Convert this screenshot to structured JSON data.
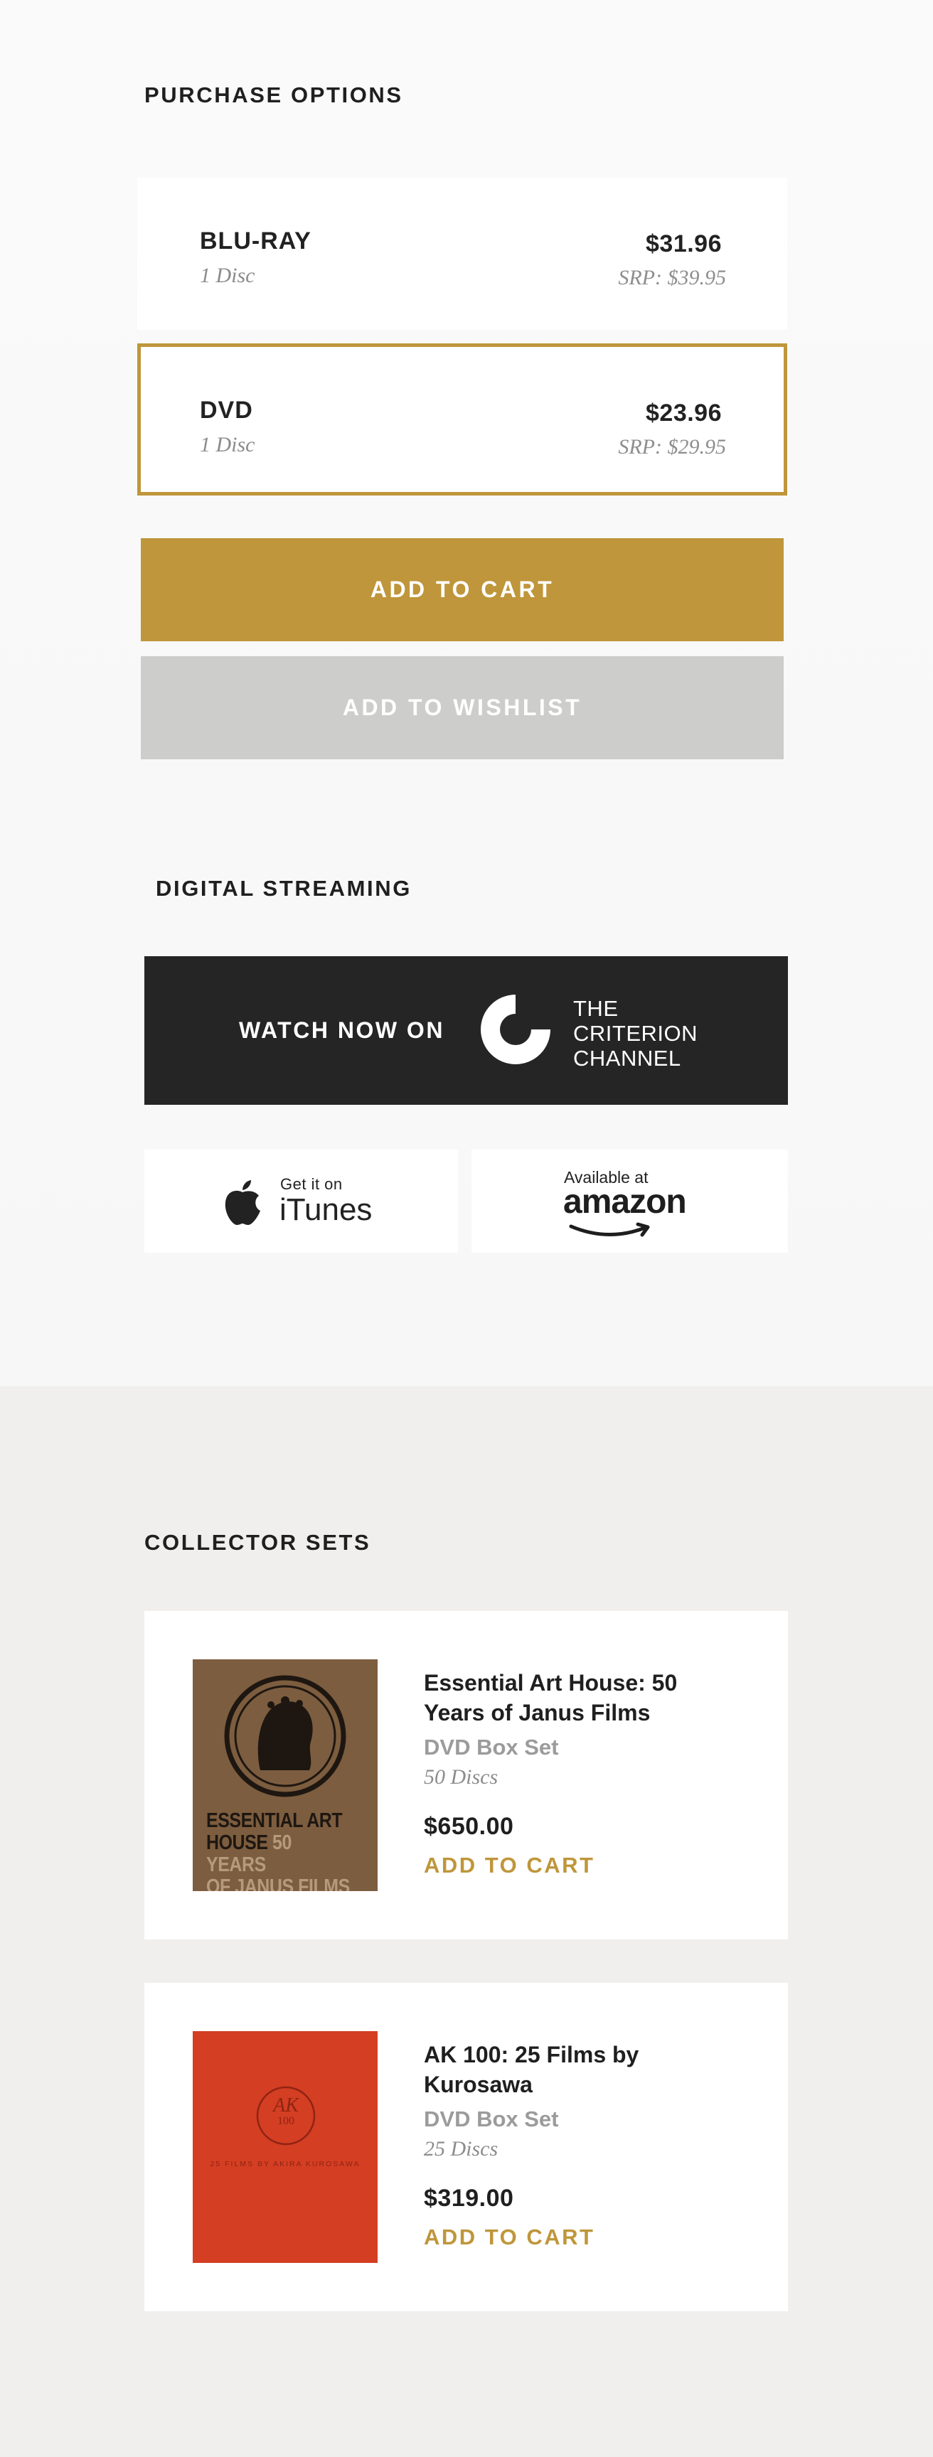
{
  "purchase": {
    "heading": "PURCHASE OPTIONS",
    "options": [
      {
        "name": "BLU-RAY",
        "discs": "1 Disc",
        "price": "$31.96",
        "srp": "SRP: $39.95",
        "selected": false
      },
      {
        "name": "DVD",
        "discs": "1 Disc",
        "price": "$23.96",
        "srp": "SRP: $29.95",
        "selected": true
      }
    ],
    "add_to_cart_label": "ADD TO CART",
    "add_to_wishlist_label": "ADD TO WISHLIST"
  },
  "streaming": {
    "heading": "DIGITAL STREAMING",
    "criterion": {
      "watch_label": "WATCH NOW ON",
      "brand_lines": [
        "THE",
        "CRITERION",
        "CHANNEL"
      ]
    },
    "itunes": {
      "small": "Get it on",
      "big": "iTunes"
    },
    "amazon": {
      "small": "Available at",
      "big": "amazon"
    }
  },
  "collector": {
    "heading": "COLLECTOR SETS",
    "sets": [
      {
        "title": "Essential Art House: 50 Years of Janus Films",
        "format": "DVD Box Set",
        "discs": "50 Discs",
        "price": "$650.00",
        "cart_label": "ADD TO CART",
        "cover_lines": [
          "ESSENTIAL ART",
          "HOUSE",
          "50 YEARS",
          "OF JANUS FILMS"
        ]
      },
      {
        "title": "AK 100: 25 Films by Kurosawa",
        "format": "DVD Box Set",
        "discs": "25 Discs",
        "price": "$319.00",
        "cart_label": "ADD TO CART",
        "cover_lines": [
          "AK",
          "100",
          "25 FILMS BY AKIRA KUROSAWA"
        ]
      }
    ]
  },
  "colors": {
    "accent_gold": "#bf963b",
    "wishlist_gray": "#cdcdcc",
    "criterion_dark": "#252525",
    "janus_brown": "#7d5d3f",
    "ak_red": "#d43e22"
  }
}
